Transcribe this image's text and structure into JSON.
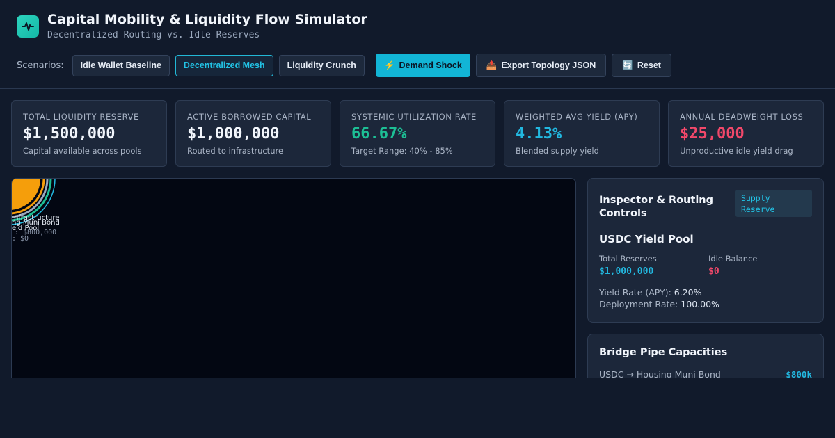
{
  "header": {
    "title": "Capital Mobility & Liquidity Flow Simulator",
    "subtitle": "Decentralized Routing vs. Idle Reserves",
    "logo_icon": "pulse-icon"
  },
  "toolbar": {
    "scenarios_label": "Scenarios:",
    "scenarios": [
      "Idle Wallet Baseline",
      "Decentralized Mesh",
      "Liquidity Crunch"
    ],
    "active_scenario": "Decentralized Mesh",
    "demand_shock": {
      "icon": "⚡",
      "label": "Demand Shock"
    },
    "export": {
      "icon": "📤",
      "label": "Export Topology JSON"
    },
    "reset": {
      "icon": "🔄",
      "label": "Reset"
    }
  },
  "kpis": [
    {
      "label": "Total Liquidity Reserve",
      "value": "$1,500,000",
      "sub": "Capital available across pools",
      "color": "#f1f5fb"
    },
    {
      "label": "Active Borrowed Capital",
      "value": "$1,000,000",
      "sub": "Routed to infrastructure",
      "color": "#f1f5fb"
    },
    {
      "label": "Systemic Utilization Rate",
      "value": "66.67%",
      "sub": "Target Range: 40% - 85%",
      "color": "#1dbf95"
    },
    {
      "label": "Weighted Avg Yield (APY)",
      "value": "4.13%",
      "sub": "Blended supply yield",
      "color": "#22b8e0"
    },
    {
      "label": "Annual Deadweight Loss",
      "value": "$25,000",
      "sub": "Unproductive idle yield drag",
      "color": "#f1486a"
    }
  ],
  "canvas": {
    "labels": [
      "Infrastructure",
      "ng Muni Bond",
      "eld Pool",
      ": $800,000",
      ": $0"
    ]
  },
  "inspector": {
    "title_line1": "Inspector & Routing",
    "title_line2": "Controls",
    "badge_line1": "Supply",
    "badge_line2": "Reserve",
    "pool_name": "USDC Yield Pool",
    "total_reserves_label": "Total Reserves",
    "total_reserves_value": "$1,000,000",
    "idle_balance_label": "Idle Balance",
    "idle_balance_value": "$0",
    "yield_rate_label": "Yield Rate (APY):",
    "yield_rate_value": "6.20%",
    "deployment_rate_label": "Deployment Rate:",
    "deployment_rate_value": "100.00%"
  },
  "bridges": {
    "title": "Bridge Pipe Capacities",
    "rows": [
      {
        "route": "USDC → Housing Muni Bond",
        "capacity": "$800k"
      }
    ]
  }
}
